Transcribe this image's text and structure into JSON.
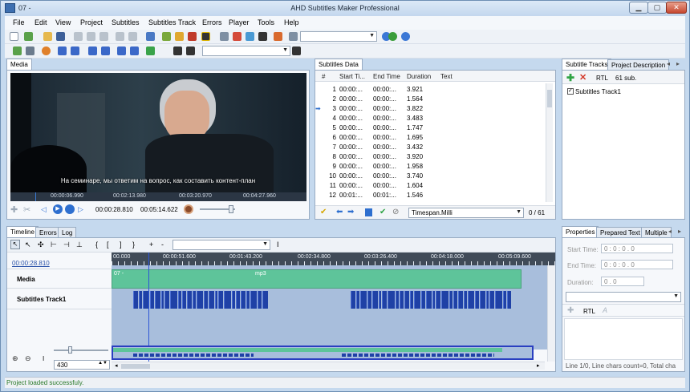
{
  "window": {
    "title_left": "07 - ",
    "title_center": "AHD Subtitles Maker Professional"
  },
  "menu": [
    "File",
    "Edit",
    "View",
    "Project",
    "Subtitles",
    "Subtitles Track",
    "Errors",
    "Player",
    "Tools",
    "Help"
  ],
  "media": {
    "tab": "Media",
    "video_subtitle": "На семинаре, мы ответим на вопрос, как составить контент-план",
    "ruler_labels": [
      "00:00:06.990",
      "00:02:13.980",
      "00:03:20.970",
      "00:04:27.960"
    ],
    "current_time": "00:00:28.810",
    "duration": "00:05:14.622"
  },
  "subtitles_data": {
    "tab": "Subtitles Data",
    "columns": [
      "#",
      "Start Ti...",
      "End Time",
      "Duration",
      "Text"
    ],
    "rows": [
      {
        "n": "1",
        "start": "00:00:...",
        "end": "00:00:...",
        "dur": "3.921",
        "text": ""
      },
      {
        "n": "2",
        "start": "00:00:...",
        "end": "00:00:...",
        "dur": "1.564",
        "text": ""
      },
      {
        "n": "3",
        "start": "00:00:...",
        "end": "00:00:...",
        "dur": "3.822",
        "text": ""
      },
      {
        "n": "4",
        "start": "00:00:...",
        "end": "00:00:...",
        "dur": "3.483",
        "text": ""
      },
      {
        "n": "5",
        "start": "00:00:...",
        "end": "00:00:...",
        "dur": "1.747",
        "text": ""
      },
      {
        "n": "6",
        "start": "00:00:...",
        "end": "00:00:...",
        "dur": "1.695",
        "text": ""
      },
      {
        "n": "7",
        "start": "00:00:...",
        "end": "00:00:...",
        "dur": "3.432",
        "text": ""
      },
      {
        "n": "8",
        "start": "00:00:...",
        "end": "00:00:...",
        "dur": "3.920",
        "text": ""
      },
      {
        "n": "9",
        "start": "00:00:...",
        "end": "00:00:...",
        "dur": "1.958",
        "text": ""
      },
      {
        "n": "10",
        "start": "00:00:...",
        "end": "00:00:...",
        "dur": "3.740",
        "text": ""
      },
      {
        "n": "11",
        "start": "00:00:...",
        "end": "00:00:...",
        "dur": "1.604",
        "text": ""
      },
      {
        "n": "12",
        "start": "00:01:...",
        "end": "00:01:...",
        "dur": "1.546",
        "text": ""
      }
    ],
    "timespan": "Timespan.Milli",
    "counter": "0 / 61"
  },
  "tracks_panel": {
    "tabs": [
      "Subtitle Tracks",
      "Project Description"
    ],
    "rtl": "RTL",
    "count": "61 sub.",
    "track_name": "Subtitles Track1"
  },
  "timeline": {
    "tabs": [
      "Timeline",
      "Errors",
      "Log"
    ],
    "current_time": "00:00:28.810",
    "ruler_labels": [
      "00.000",
      "00:00:51.600",
      "00:01:43.200",
      "00:02:34.800",
      "00:03:26.400",
      "00:04:18.000",
      "00:05:09.600"
    ],
    "media_label": "Media",
    "media_clip": "07 -",
    "media_clip_name": "mp3",
    "track_label": "Subtitles Track1",
    "zoom_value": "430"
  },
  "properties": {
    "tabs": [
      "Properties",
      "Prepared Text",
      "Multiple"
    ],
    "start_label": "Start Time:",
    "start_value": "0 : 0 : 0 . 0",
    "end_label": "End Time:",
    "end_value": "0 : 0 : 0 . 0",
    "dur_label": "Duration:",
    "dur_value": "0 . 0",
    "rtl": "RTL",
    "footer": "Line 1/0, Line chars count=0, Total cha"
  },
  "status": "Project loaded successfuly."
}
